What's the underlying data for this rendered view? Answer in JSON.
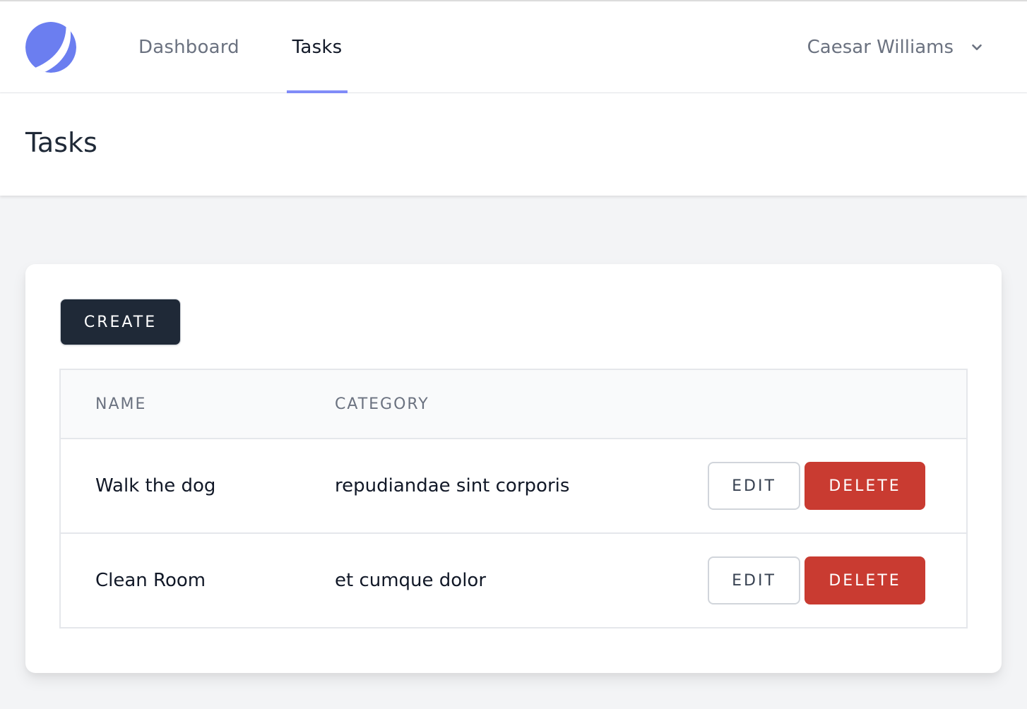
{
  "nav": {
    "logo": "planet-logo",
    "links": [
      {
        "label": "Dashboard",
        "active": false
      },
      {
        "label": "Tasks",
        "active": true
      }
    ],
    "user": {
      "name": "Caesar Williams",
      "icon": "chevron-down-icon"
    },
    "accent_color": "#818cf8",
    "logo_color": "#6b7ef0"
  },
  "header": {
    "title": "Tasks"
  },
  "card": {
    "create_label": "CREATE",
    "table": {
      "columns": [
        "NAME",
        "CATEGORY"
      ],
      "rows": [
        {
          "name": "Walk the dog",
          "category": "repudiandae sint corporis",
          "edit_label": "EDIT",
          "delete_label": "DELETE"
        },
        {
          "name": "Clean Room",
          "category": "et cumque dolor",
          "edit_label": "EDIT",
          "delete_label": "DELETE"
        }
      ]
    },
    "delete_color": "#c93b31"
  }
}
